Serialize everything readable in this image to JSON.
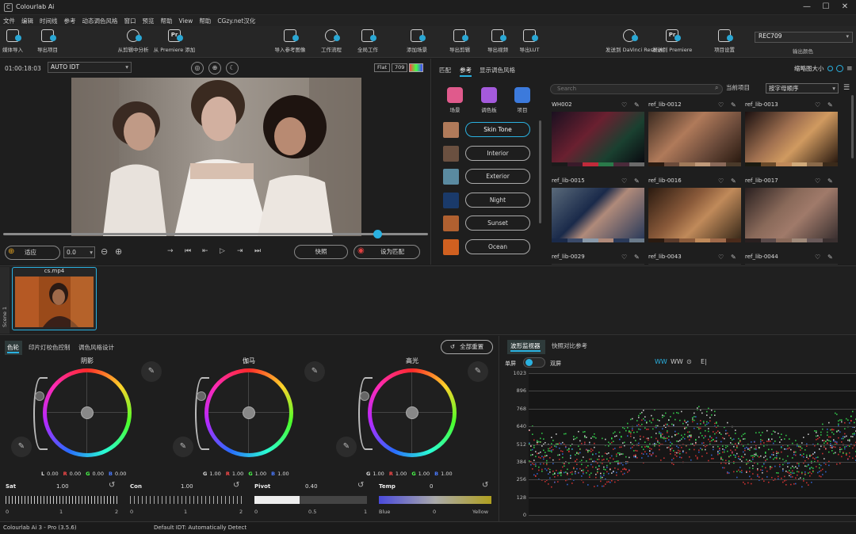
{
  "app": {
    "title": "Colourlab Ai"
  },
  "menu": [
    "文件",
    "编辑",
    "时间线",
    "参考",
    "动态调色风格",
    "窗口",
    "预览",
    "帮助",
    "View",
    "帮助",
    "CGzy.net汉化"
  ],
  "toolbar": {
    "items": [
      {
        "label": "媒体导入",
        "icon": "media-import-icon"
      },
      {
        "label": "导出项目",
        "icon": "export-project-icon"
      },
      {
        "label": "从剪辑中分析",
        "icon": "analyze-icon"
      },
      {
        "label": "从 Premiere 添加",
        "icon": "premiere-add-icon"
      },
      {
        "label": "导入参考图像",
        "icon": "import-reference-icon"
      },
      {
        "label": "工作流程",
        "icon": "workflow-icon"
      },
      {
        "label": "全局工作",
        "icon": "global-work-icon"
      },
      {
        "label": "添加场景",
        "icon": "add-scene-icon"
      },
      {
        "label": "导出剪辑",
        "icon": "export-clip-icon"
      },
      {
        "label": "导出视频",
        "icon": "export-video-icon"
      },
      {
        "label": "导出LUT",
        "icon": "export-lut-icon"
      },
      {
        "label": "发送到 DaVinci Resolve",
        "icon": "davinci-icon"
      },
      {
        "label": "发送到 Premiere",
        "icon": "premiere-send-icon"
      },
      {
        "label": "项目设置",
        "icon": "project-settings-icon"
      }
    ],
    "color_space": "REC709",
    "color_space_label": "输出颜色"
  },
  "viewer": {
    "timecode": "01:00:18:03",
    "idt": "AUTO IDT",
    "flat_label": "Flat",
    "p709_label": "709",
    "fit_label": "适应",
    "zoom_value": "0.0",
    "quick_label": "快照",
    "reference_label": "设为匹配",
    "progress": 0.88
  },
  "refpanel": {
    "tabs": [
      "匹配",
      "参考",
      "显示调色风格"
    ],
    "active_tab": 1,
    "thumb_size_label": "缩略图大小",
    "category_buttons": [
      {
        "label": "场景",
        "color": "#e05a8c"
      },
      {
        "label": "调色板",
        "color": "#a45adc"
      },
      {
        "label": "项目",
        "color": "#3c7adc"
      }
    ],
    "categories": [
      {
        "label": "Skin Tone",
        "swatch": "#b07a5a",
        "active": true
      },
      {
        "label": "Interior",
        "swatch": "#6a5040",
        "active": false
      },
      {
        "label": "Exterior",
        "swatch": "#5a8aa0",
        "active": false
      },
      {
        "label": "Night",
        "swatch": "#1a3a6a",
        "active": false
      },
      {
        "label": "Sunset",
        "swatch": "#b06030",
        "active": false
      },
      {
        "label": "Ocean",
        "swatch": "#d06020",
        "active": false
      }
    ],
    "search_placeholder": "Search",
    "current_project_label": "当前项目",
    "sort": "按字母顺序",
    "cards": [
      {
        "name": "WH002",
        "bg": "linear-gradient(135deg,#1a1020,#6a2030 40%,#1a4030 70%,#0a0a10)",
        "palette": [
          "#1a1a1a",
          "#3a1a2a",
          "#c02a3a",
          "#2a7a4a",
          "#4a2a3a",
          "#6a6a6a"
        ]
      },
      {
        "name": "ref_lib-0012",
        "bg": "linear-gradient(135deg,#3a2a20,#b07a5a 40%,#6a4a3a 70%,#2a1a10)",
        "palette": [
          "#2a1a10",
          "#6a4a3a",
          "#a07a5a",
          "#c09a7a",
          "#8a6a5a",
          "#4a3a2a"
        ]
      },
      {
        "name": "ref_lib-0013",
        "bg": "linear-gradient(135deg,#1a1010,#a07050 40%,#d09a60 60%,#2a1a10)",
        "palette": [
          "#1a1a10",
          "#6a4a2a",
          "#c08a5a",
          "#d0aa7a",
          "#8a6a4a",
          "#3a2a1a"
        ]
      },
      {
        "name": "ref_lib-0015",
        "bg": "linear-gradient(135deg,#5a6a7a,#1a2a4a 40%,#b08a7a 55%,#2a3a5a)",
        "palette": [
          "#1a2a4a",
          "#3a4a6a",
          "#8a9aaa",
          "#b08a7a",
          "#2a3a5a",
          "#6a7a8a"
        ]
      },
      {
        "name": "ref_lib-0016",
        "bg": "linear-gradient(135deg,#2a1a10,#8a5a3a 40%,#c08a5a 60%,#3a2a1a)",
        "palette": [
          "#2a1a10",
          "#5a3a2a",
          "#8a5a3a",
          "#c08a5a",
          "#a06a4a",
          "#4a2a1a"
        ]
      },
      {
        "name": "ref_lib-0017",
        "bg": "linear-gradient(135deg,#2a2020,#8a6a5a 40%,#a07a6a 60%,#3a3030)",
        "palette": [
          "#2a2020",
          "#5a4a4a",
          "#8a6a5a",
          "#a08a7a",
          "#6a5a5a",
          "#3a3030"
        ]
      },
      {
        "name": "ref_lib-0029",
        "bg": "#333",
        "palette": []
      },
      {
        "name": "ref_lib-0043",
        "bg": "#333",
        "palette": []
      },
      {
        "name": "ref_lib-0044",
        "bg": "#333",
        "palette": []
      }
    ]
  },
  "clips": {
    "scene_label": "Scene 1",
    "items": [
      {
        "name": "cs.mp4"
      }
    ]
  },
  "color": {
    "tabs": [
      "色轮",
      "印片灯校色控制",
      "调色风格设计"
    ],
    "reset_all": "全部重置",
    "wheels": [
      {
        "title": "阴影",
        "L": "0.00",
        "R": "0.00",
        "G": "0.00",
        "B": "0.00"
      },
      {
        "title": "伽马",
        "L": "1.00",
        "R": "1.00",
        "G": "1.00",
        "B": "1.00"
      },
      {
        "title": "高光",
        "L": "1.00",
        "R": "1.00",
        "G": "1.00",
        "B": "1.00"
      }
    ],
    "wheel_l_labels": [
      "L",
      "G",
      "G"
    ],
    "sliders": [
      {
        "label": "Sat",
        "value": "1.00",
        "ticks": [
          "0",
          "1",
          "2"
        ]
      },
      {
        "label": "Con",
        "value": "1.00",
        "ticks": [
          "0",
          "1",
          "2"
        ]
      },
      {
        "label": "Pivot",
        "value": "0.40",
        "ticks": [
          "0",
          "0.5",
          "1"
        ]
      },
      {
        "label": "Temp",
        "value": "0",
        "ticks": [
          "Blue",
          "0",
          "Yellow"
        ]
      }
    ]
  },
  "wave": {
    "tabs": [
      "波形监视器",
      "快照对比参考"
    ],
    "single": "单屏",
    "double": "双屏",
    "modes": [
      "WW",
      "WW",
      "⊙",
      "E|"
    ],
    "yticks": [
      "1023",
      "896",
      "768",
      "640",
      "512",
      "384",
      "256",
      "128",
      "0"
    ]
  },
  "status": {
    "version": "Colourlab Ai 3 - Pro (3.5.6)",
    "idt": "Default IDT: Automatically Detect"
  }
}
